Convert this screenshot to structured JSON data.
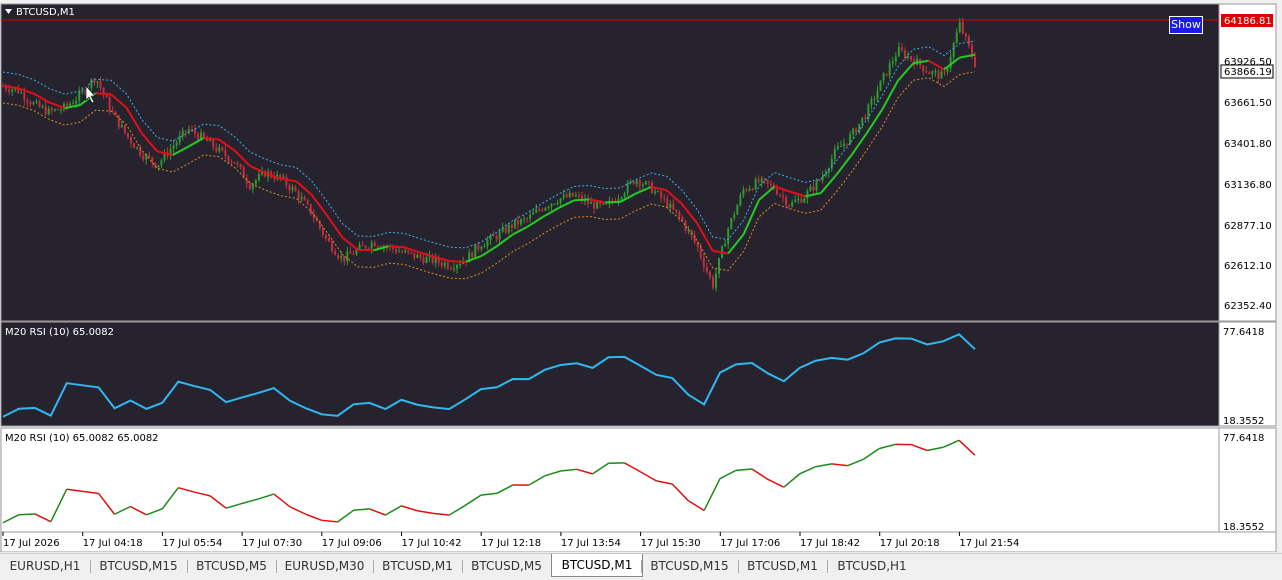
{
  "window": {
    "title": "BTCUSD,M1"
  },
  "main_panel": {
    "symbol_label": "BTCUSD,M1",
    "show_button": "Show",
    "price_labels": [
      "64186.81",
      "63926.50",
      "63866.19",
      "63661.50",
      "63401.80",
      "63136.80",
      "62877.10",
      "62612.10",
      "62352.40"
    ],
    "red_level_label": "64186.81",
    "current_price_label": "63866.19"
  },
  "rsi_panel_1": {
    "label": "M20 RSI (10) 65.0082",
    "max_label": "77.6418",
    "min_label": "18.3552"
  },
  "rsi_panel_2": {
    "label": "M20 RSI (10) 65.0082 65.0082",
    "max_label": "77.6418",
    "min_label": "18.3552"
  },
  "time_axis": [
    "17 Jul 2026",
    "17 Jul 04:18",
    "17 Jul 05:54",
    "17 Jul 07:30",
    "17 Jul 09:06",
    "17 Jul 10:42",
    "17 Jul 12:18",
    "17 Jul 13:54",
    "17 Jul 15:30",
    "17 Jul 17:06",
    "17 Jul 18:42",
    "17 Jul 20:18",
    "17 Jul 21:54"
  ],
  "tabs": [
    {
      "label": "EURUSD,H1",
      "active": false
    },
    {
      "label": "BTCUSD,M15",
      "active": false
    },
    {
      "label": "BTCUSD,M5",
      "active": false
    },
    {
      "label": "EURUSD,M30",
      "active": false
    },
    {
      "label": "BTCUSD,M1",
      "active": false
    },
    {
      "label": "BTCUSD,M5",
      "active": false
    },
    {
      "label": "BTCUSD,M1",
      "active": true
    },
    {
      "label": "BTCUSD,M15",
      "active": false
    },
    {
      "label": "BTCUSD,M1",
      "active": false
    },
    {
      "label": "BTCUSD,H1",
      "active": false
    }
  ],
  "colors": {
    "chart_bg": "#26232f",
    "price_axis_bg": "#ffffff",
    "candle_up": "#2e9b2e",
    "candle_down": "#c0303a",
    "ma_red": "#e0101a",
    "ma_green": "#22cc22",
    "band_upper": "#3ab0e8",
    "band_lower": "#e08a20",
    "rsi_line": "#30b8f0",
    "rsi2_up": "#1a8a1a",
    "rsi2_down": "#e01010",
    "level_line": "#e00000"
  },
  "chart_data": {
    "type": "line",
    "price": {
      "ylim": [
        62200,
        64250
      ],
      "close": [
        63720,
        63690,
        63600,
        63550,
        63580,
        63660,
        63780,
        63560,
        63400,
        63280,
        63210,
        63330,
        63440,
        63380,
        63300,
        63230,
        63080,
        63160,
        63120,
        63030,
        62900,
        62720,
        62600,
        62660,
        62710,
        62680,
        62640,
        62610,
        62590,
        62560,
        62600,
        62700,
        62750,
        62820,
        62860,
        62940,
        62990,
        63010,
        62960,
        62930,
        63020,
        63120,
        63060,
        62960,
        62850,
        62680,
        62430,
        62800,
        63050,
        63100,
        63060,
        62950,
        63010,
        63120,
        63300,
        63400,
        63550,
        63760,
        63950,
        63890,
        63810,
        63780,
        64120,
        63866
      ]
    },
    "red_level": 64186.81,
    "current_price": 63866.19,
    "rsi": {
      "ylim": [
        18.3552,
        77.6418
      ],
      "values": [
        20.5,
        25.8,
        26.3,
        21.2,
        42.6,
        41.2,
        39.8,
        26.1,
        31.2,
        25.7,
        29.7,
        43.6,
        40.7,
        38.2,
        30.1,
        33.2,
        36.1,
        39.4,
        31.1,
        26.1,
        22.1,
        21.1,
        28.7,
        29.6,
        25.6,
        31.6,
        28.4,
        26.7,
        25.5,
        31.9,
        38.7,
        39.9,
        45.4,
        45.3,
        51.4,
        54.6,
        55.7,
        52.7,
        59.7,
        59.9,
        54.1,
        48.1,
        46.0,
        35.1,
        28.6,
        49.6,
        55.0,
        55.9,
        49.1,
        43.9,
        52.7,
        57.4,
        59.3,
        58.1,
        62.3,
        69.4,
        72.1,
        72.0,
        68.1,
        70.2,
        74.8,
        65.0
      ]
    }
  }
}
